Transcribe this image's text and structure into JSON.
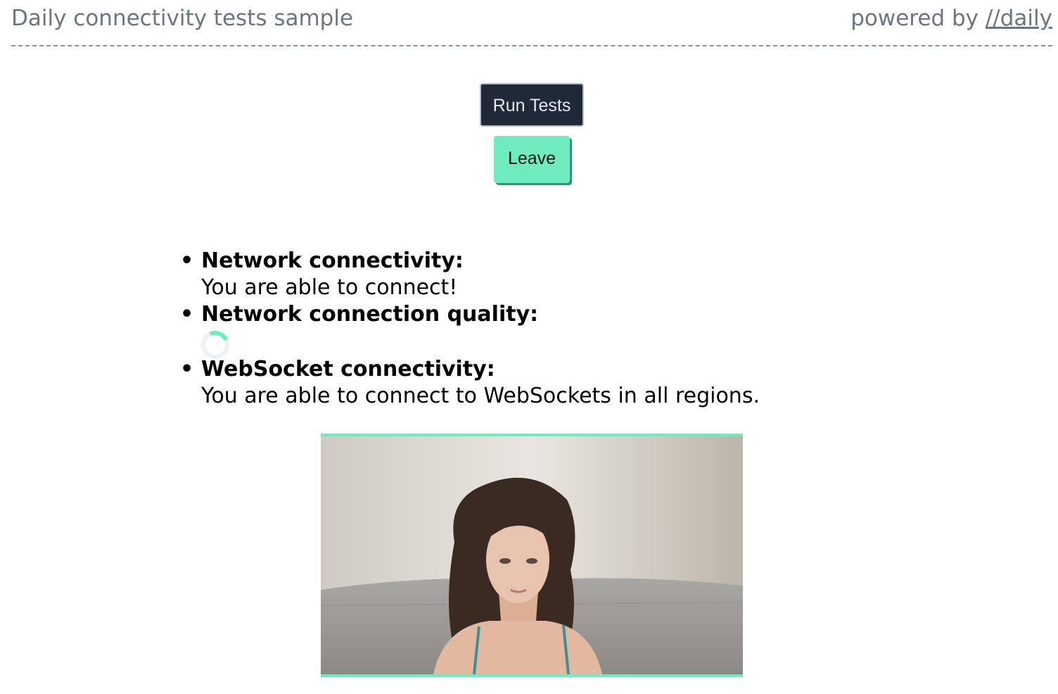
{
  "header": {
    "title": "Daily connectivity tests sample",
    "powered_by": "powered by",
    "brand_link": "//daily"
  },
  "buttons": {
    "run_tests": "Run Tests",
    "leave": "Leave"
  },
  "results": {
    "bullet": "•",
    "items": [
      {
        "label": "Network connectivity:",
        "value": "You are able to connect!"
      },
      {
        "label": "Network connection quality:",
        "value": ""
      },
      {
        "label": "WebSocket connectivity:",
        "value": "You are able to connect to WebSockets in all regions."
      }
    ]
  },
  "colors": {
    "accent": "#6eecc0",
    "dark_button": "#1f2937",
    "header_text": "#6b7680"
  },
  "icons": {
    "loading": "loading-spinner-icon"
  }
}
